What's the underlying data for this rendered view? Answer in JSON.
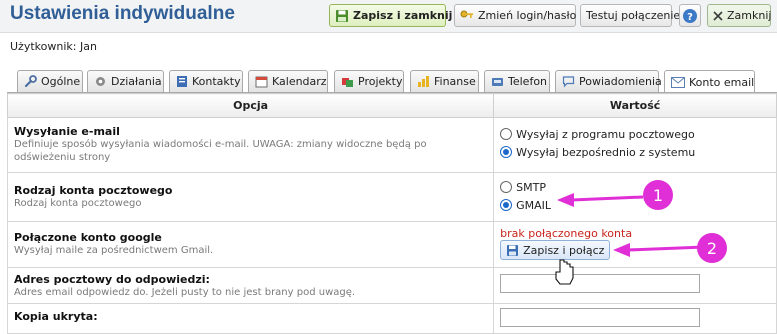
{
  "header": {
    "title": "Ustawienia indywidualne",
    "save_close": "Zapisz i zamknij",
    "change_login": "Zmień login/hasło",
    "test_connection": "Testuj połączenie",
    "help_glyph": "?",
    "close": "Zamknij"
  },
  "user_line": "Użytkownik: Jan",
  "tabs": [
    {
      "label": "Ogólne",
      "icon": "wrench-icon"
    },
    {
      "label": "Działania",
      "icon": "gear-icon"
    },
    {
      "label": "Kontakty",
      "icon": "contacts-icon"
    },
    {
      "label": "Kalendarz",
      "icon": "calendar-icon"
    },
    {
      "label": "Projekty",
      "icon": "projects-icon"
    },
    {
      "label": "Finanse",
      "icon": "finance-icon"
    },
    {
      "label": "Telefon",
      "icon": "phone-icon"
    },
    {
      "label": "Powiadomienia",
      "icon": "chat-icon"
    },
    {
      "label": "Konto email",
      "icon": "envelope-icon",
      "active": true
    }
  ],
  "table": {
    "col_option": "Opcja",
    "col_value": "Wartość",
    "rows": [
      {
        "title": "Wysyłanie e-mail",
        "desc": "Definiuje sposób wysyłania wiadomości e-mail. UWAGA: zmiany widoczne będą po odświeżeniu strony",
        "radios": [
          {
            "label": "Wysyłaj z programu pocztowego",
            "checked": false
          },
          {
            "label": "Wysyłaj bezpośrednio z systemu",
            "checked": true
          }
        ]
      },
      {
        "title": "Rodzaj konta pocztowego",
        "desc": "Rodzaj konta pocztowego",
        "radios": [
          {
            "label": "SMTP",
            "checked": false
          },
          {
            "label": "GMAIL",
            "checked": true
          }
        ]
      },
      {
        "title": "Połączone konto google",
        "desc": "Wysyłaj maile za pośrednictwem Gmail.",
        "status": "brak połączonego konta",
        "button": "Zapisz i połącz"
      },
      {
        "title": "Adres pocztowy do odpowiedzi:",
        "desc": "Adres email odpowiedz do. Jeżeli pusty to nie jest brany pod uwagę.",
        "input_value": ""
      },
      {
        "title": "Kopia ukryta:"
      }
    ]
  },
  "annotations": {
    "one": "1",
    "two": "2"
  },
  "colors": {
    "accent_title": "#2f5f96",
    "annotation": "#e02fd7",
    "error": "#c8241b"
  }
}
